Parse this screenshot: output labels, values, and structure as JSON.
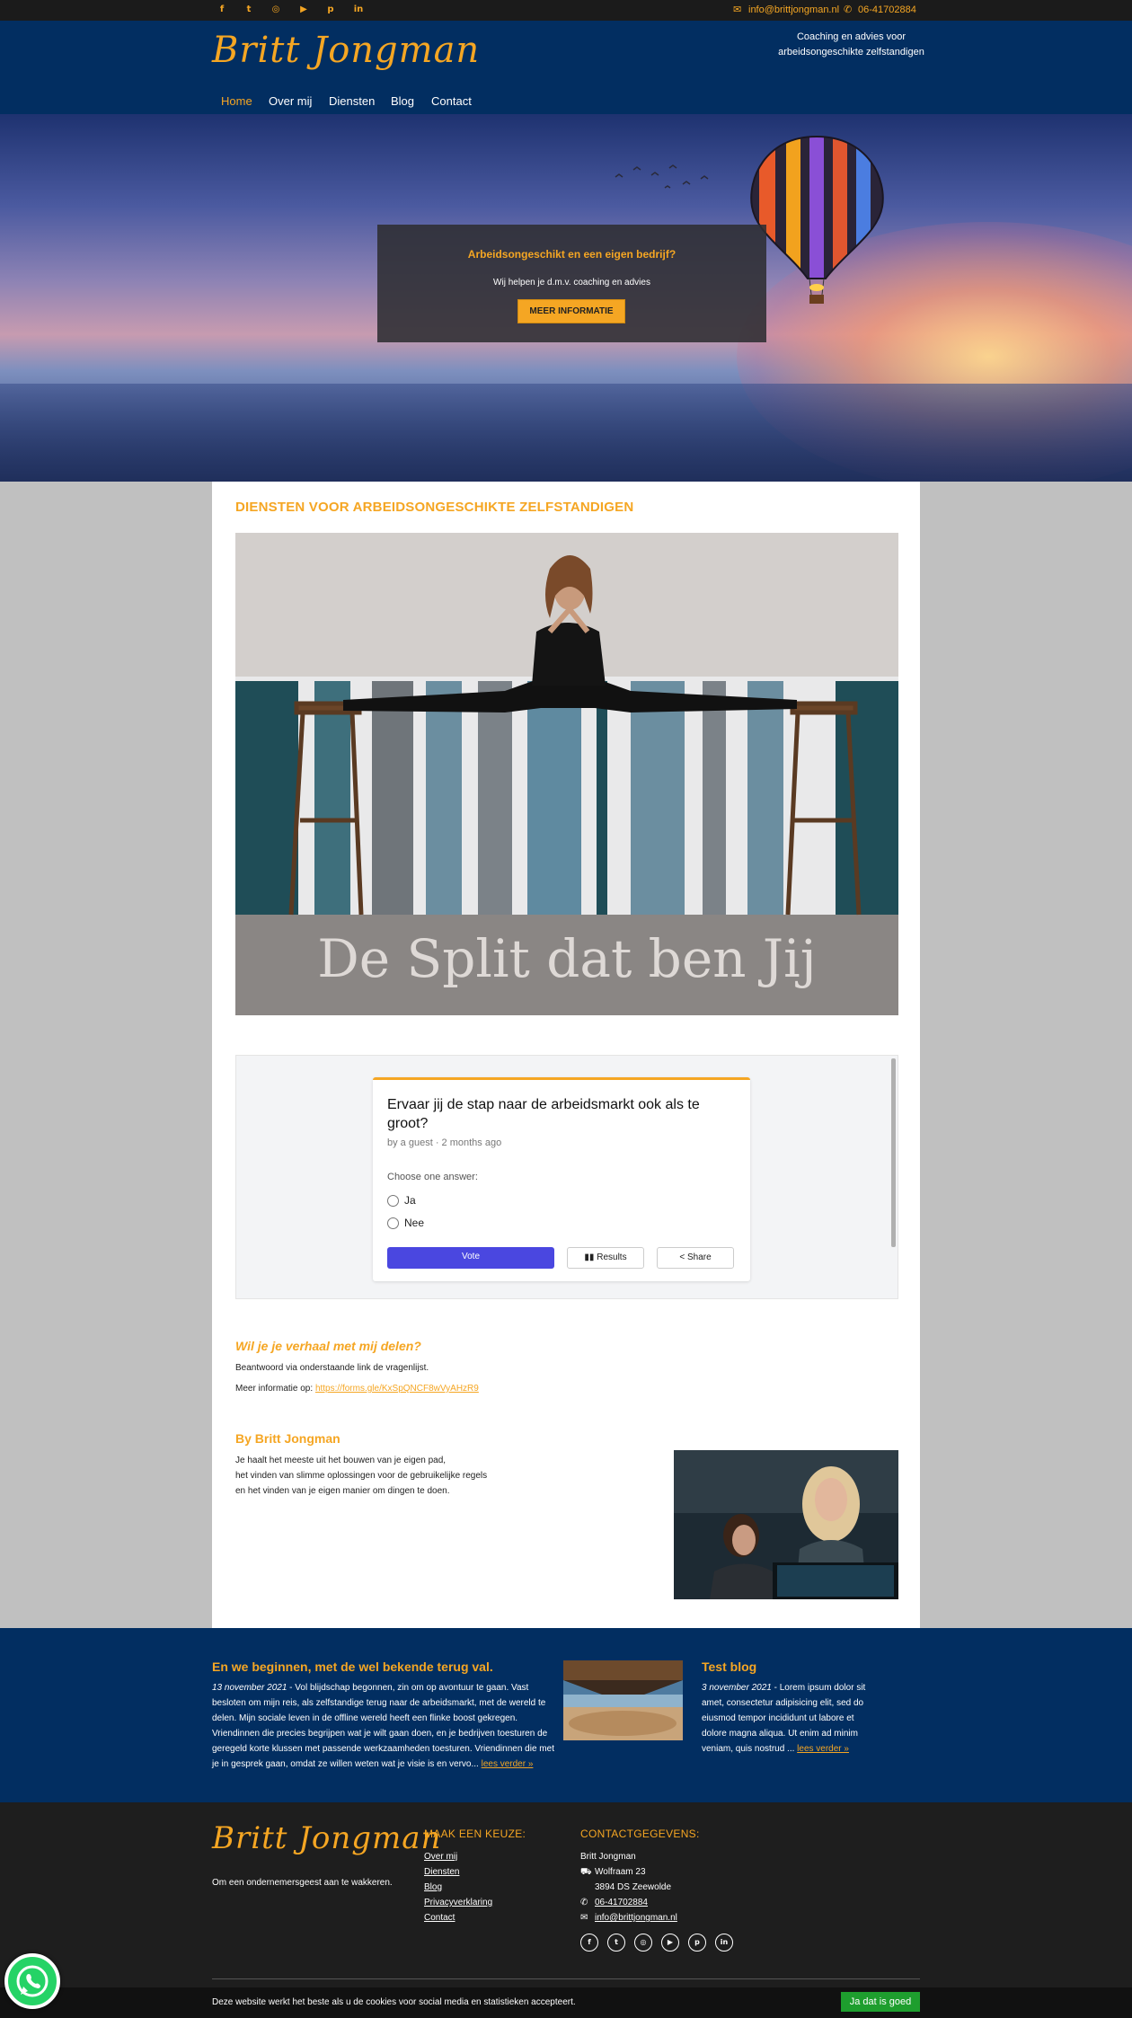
{
  "topbar": {
    "social": [
      "facebook-icon",
      "twitter-icon",
      "instagram-icon",
      "youtube-icon",
      "pinterest-icon",
      "linkedin-icon"
    ],
    "email": "info@brittjongman.nl",
    "phone": "06-41702884"
  },
  "header": {
    "logo": "Britt Jongman",
    "tagline_1": "Coaching en advies voor",
    "tagline_2": "arbeidsongeschikte zelfstandigen"
  },
  "nav": {
    "items": [
      {
        "label": "Home"
      },
      {
        "label": "Over mij"
      },
      {
        "label": "Diensten"
      },
      {
        "label": "Blog"
      },
      {
        "label": "Contact"
      }
    ]
  },
  "hero": {
    "heading": "Arbeidsongeschikt en een eigen bedrijf?",
    "subtext": "Wij helpen je d.m.v. coaching en advies",
    "button": "MEER INFORMATIE"
  },
  "main": {
    "section_title": "DIENSTEN VOOR ARBEIDSONGESCHIKTE ZELFSTANDIGEN",
    "photo_caption": "De Split dat ben Jij",
    "poll": {
      "question": "Ervaar jij de stap naar de arbeidsmarkt ook als te groot?",
      "meta": "by a guest · 2 months ago",
      "choose": "Choose one answer:",
      "options": [
        "Ja",
        "Nee"
      ],
      "vote": "Vote",
      "results": "Results",
      "share": "Share"
    },
    "story": {
      "heading": "Wil je je verhaal met mij delen?",
      "text": "Beantwoord via onderstaande link de vragenlijst.",
      "more_label": "Meer informatie op: ",
      "more_link": "https://forms.gle/KxSpQNCF8wVyAHzR9"
    },
    "author": {
      "heading": "By Britt Jongman",
      "line1": "Je haalt het meeste uit het bouwen van je eigen pad,",
      "line2": "het vinden van slimme oplossingen voor de gebruikelijke regels",
      "line3": "en het vinden van je eigen manier om dingen te doen."
    }
  },
  "blog": {
    "post1": {
      "title": "En we beginnen, met de wel bekende terug val.",
      "date": "13 november 2021",
      "text": " - Vol blijdschap begonnen, zin om op avontuur te gaan. Vast besloten om mijn reis, als zelfstandige terug naar de arbeidsmarkt, met de wereld te delen. Mijn sociale leven in de offline wereld heeft een flinke boost gekregen. Vriendinnen die precies begrijpen wat je wilt gaan doen, en je bedrijven toesturen de geregeld korte klussen met passende werkzaamheden toesturen. Vriendinnen die met je in gesprek gaan, omdat ze willen weten wat je visie is en vervo... ",
      "more": "lees verder »"
    },
    "post2": {
      "title": "Test blog",
      "date": "3 november 2021",
      "text": " - Lorem ipsum dolor sit amet, consectetur adipisicing elit, sed do eiusmod tempor incididunt ut labore et dolore magna aliqua. Ut enim ad minim veniam, quis nostrud ... ",
      "more": "lees verder »"
    }
  },
  "footer": {
    "logo": "Britt Jongman",
    "slogan": "Om een ondernemersgeest aan te wakkeren.",
    "menu_title": "MAAK EEN KEUZE:",
    "menu": [
      "Over mij",
      "Diensten",
      "Blog",
      "Privacyverklaring",
      "Contact"
    ],
    "contact_title": "CONTACTGEGEVENS:",
    "name": "Britt Jongman",
    "street": "Wolfraam 23",
    "city": "3894 DS Zeewolde",
    "phone": "06-41702884",
    "email": "info@brittjongman.nl"
  },
  "cookie": {
    "text": "Deze website werkt het beste als u de cookies voor social media en statistieken accepteert.",
    "button": "Ja dat is goed"
  },
  "colors": {
    "accent": "#f5a623",
    "navy": "#022e61",
    "dark": "#1e1e1e"
  }
}
